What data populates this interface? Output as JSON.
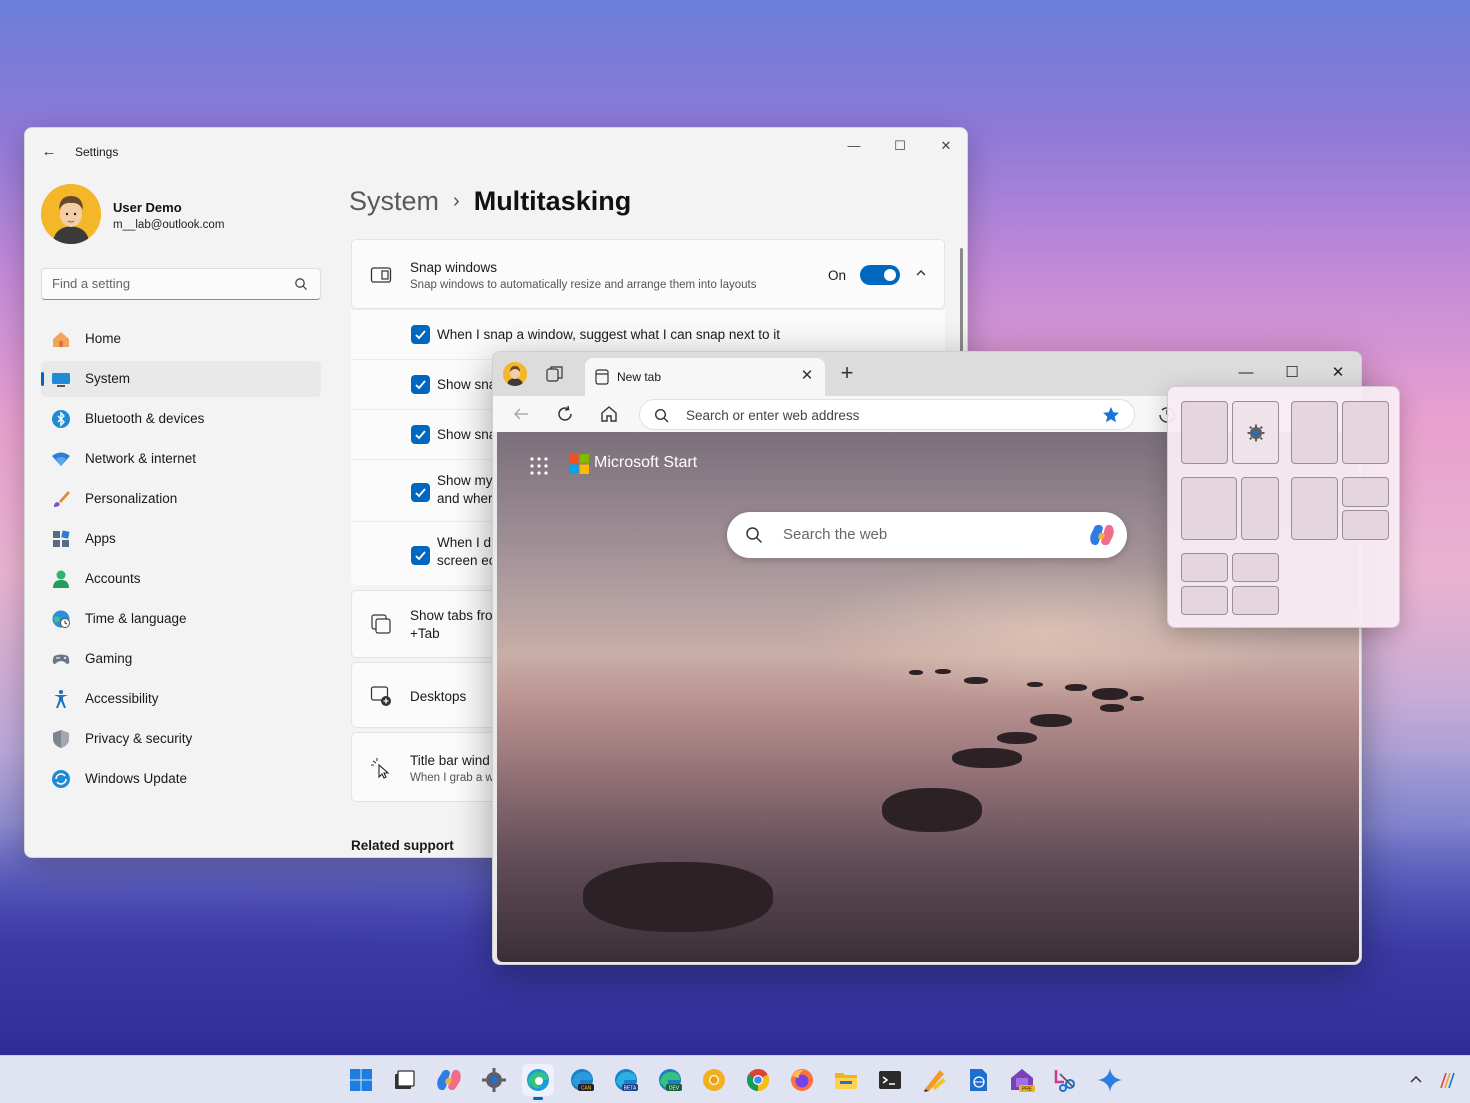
{
  "settings": {
    "title": "Settings",
    "user": {
      "name": "User Demo",
      "email": "m__lab@outlook.com"
    },
    "search_placeholder": "Find a setting",
    "nav": [
      {
        "label": "Home",
        "icon": "home-icon"
      },
      {
        "label": "System",
        "icon": "system-icon",
        "active": true
      },
      {
        "label": "Bluetooth & devices",
        "icon": "bluetooth-icon"
      },
      {
        "label": "Network & internet",
        "icon": "wifi-icon"
      },
      {
        "label": "Personalization",
        "icon": "brush-icon"
      },
      {
        "label": "Apps",
        "icon": "apps-icon"
      },
      {
        "label": "Accounts",
        "icon": "person-icon"
      },
      {
        "label": "Time & language",
        "icon": "globe-clock-icon"
      },
      {
        "label": "Gaming",
        "icon": "gamepad-icon"
      },
      {
        "label": "Accessibility",
        "icon": "accessibility-icon"
      },
      {
        "label": "Privacy & security",
        "icon": "shield-icon"
      },
      {
        "label": "Windows Update",
        "icon": "update-icon"
      }
    ],
    "breadcrumb": {
      "parent": "System",
      "separator": "›",
      "current": "Multitasking"
    },
    "snap": {
      "title": "Snap windows",
      "subtitle": "Snap windows to automatically resize and arrange them into layouts",
      "toggle_label": "On",
      "options": [
        {
          "line1": "When I snap a window, suggest what I can snap next to it",
          "line2": ""
        },
        {
          "line1": "Show sna",
          "line2": ""
        },
        {
          "line1": "Show sna",
          "line2": ""
        },
        {
          "line1": "Show my",
          "line2": "and wher"
        },
        {
          "line1": "When I d",
          "line2": "screen ec"
        }
      ]
    },
    "tabs_card": {
      "line1": "Show tabs fro",
      "line2": "+Tab"
    },
    "desktops_card": {
      "title": "Desktops"
    },
    "titlebar_card": {
      "title": "Title bar wind",
      "subtitle": "When I grab a w"
    },
    "related_support": "Related support"
  },
  "browser": {
    "tab_label": "New tab",
    "address_placeholder": "Search or enter web address",
    "brand": "Microsoft Start",
    "search_placeholder": "Search the web"
  },
  "colors": {
    "accent": "#0067c0",
    "taskbar": "#dfe3f2"
  },
  "taskbar_icons": [
    "start-icon",
    "task-view-icon",
    "copilot-icon",
    "settings-icon",
    "edge-icon",
    "edge-canary-icon",
    "edge-beta-icon",
    "edge-dev-icon",
    "chrome-canary-icon",
    "chrome-icon",
    "firefox-icon",
    "file-explorer-icon",
    "terminal-icon",
    "paint-tools-icon",
    "notepad-web-icon",
    "powertoys-preview-icon",
    "snipping-tool-icon",
    "copilot-sparkle-icon"
  ]
}
